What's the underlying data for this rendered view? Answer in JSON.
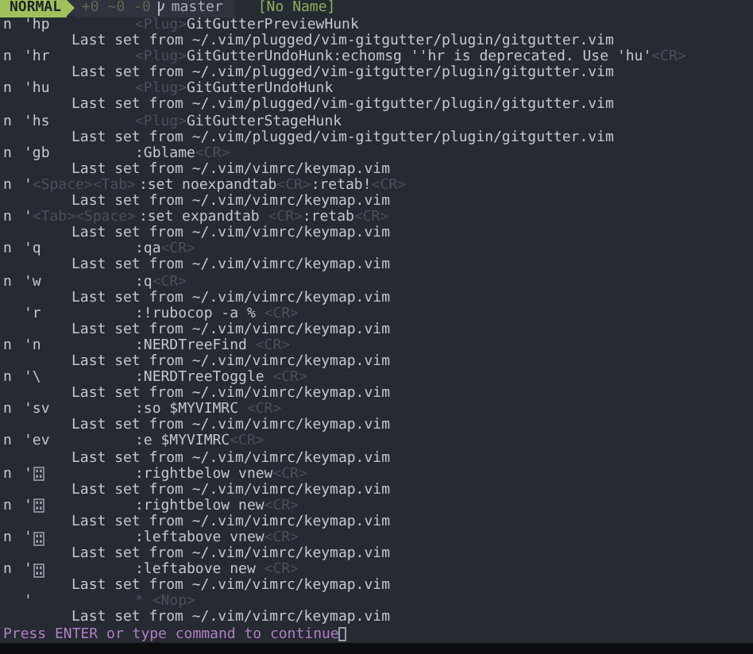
{
  "statusline": {
    "mode": "NORMAL",
    "git_changes": "+0 ~0 -0",
    "branch": "master",
    "filename": "[No Name]"
  },
  "mappings": [
    {
      "mode": "n",
      "lhs": [
        {
          "text": "'hp",
          "kind": "text"
        }
      ],
      "rhs": [
        {
          "text": "<Plug>",
          "kind": "special"
        },
        {
          "text": "GitGutterPreviewHunk",
          "kind": "text"
        }
      ],
      "source": "Last set from ~/.vim/plugged/vim-gitgutter/plugin/gitgutter.vim"
    },
    {
      "mode": "n",
      "lhs": [
        {
          "text": "'hr",
          "kind": "text"
        }
      ],
      "rhs": [
        {
          "text": "<Plug>",
          "kind": "special"
        },
        {
          "text": "GitGutterUndoHunk:echomsg ''hr is deprecated. Use 'hu'",
          "kind": "text"
        },
        {
          "text": "<CR>",
          "kind": "special"
        }
      ],
      "source": "Last set from ~/.vim/plugged/vim-gitgutter/plugin/gitgutter.vim"
    },
    {
      "mode": "n",
      "lhs": [
        {
          "text": "'hu",
          "kind": "text"
        }
      ],
      "rhs": [
        {
          "text": "<Plug>",
          "kind": "special"
        },
        {
          "text": "GitGutterUndoHunk",
          "kind": "text"
        }
      ],
      "source": "Last set from ~/.vim/plugged/vim-gitgutter/plugin/gitgutter.vim"
    },
    {
      "mode": "n",
      "lhs": [
        {
          "text": "'hs",
          "kind": "text"
        }
      ],
      "rhs": [
        {
          "text": "<Plug>",
          "kind": "special"
        },
        {
          "text": "GitGutterStageHunk",
          "kind": "text"
        }
      ],
      "source": "Last set from ~/.vim/plugged/vim-gitgutter/plugin/gitgutter.vim"
    },
    {
      "mode": "n",
      "lhs": [
        {
          "text": "'gb",
          "kind": "text"
        }
      ],
      "rhs": [
        {
          "text": ":Gblame",
          "kind": "text"
        },
        {
          "text": "<CR>",
          "kind": "special"
        }
      ],
      "source": "Last set from ~/.vim/vimrc/keymap.vim"
    },
    {
      "mode": "n",
      "lhs": [
        {
          "text": "'",
          "kind": "text"
        },
        {
          "text": "<Space><Tab>",
          "kind": "special"
        }
      ],
      "rhs": [
        {
          "text": ":set noexpandtab",
          "kind": "text"
        },
        {
          "text": "<CR>",
          "kind": "special"
        },
        {
          "text": ":retab!",
          "kind": "text"
        },
        {
          "text": "<CR>",
          "kind": "special"
        }
      ],
      "source": "Last set from ~/.vim/vimrc/keymap.vim"
    },
    {
      "mode": "n",
      "lhs": [
        {
          "text": "'",
          "kind": "text"
        },
        {
          "text": "<Tab><Space>",
          "kind": "special"
        }
      ],
      "rhs": [
        {
          "text": ":set expandtab ",
          "kind": "text"
        },
        {
          "text": "<CR>",
          "kind": "special"
        },
        {
          "text": ":retab",
          "kind": "text"
        },
        {
          "text": "<CR>",
          "kind": "special"
        }
      ],
      "source": "Last set from ~/.vim/vimrc/keymap.vim"
    },
    {
      "mode": "n",
      "lhs": [
        {
          "text": "'q",
          "kind": "text"
        }
      ],
      "rhs": [
        {
          "text": ":qa",
          "kind": "text"
        },
        {
          "text": "<CR>",
          "kind": "special"
        }
      ],
      "source": "Last set from ~/.vim/vimrc/keymap.vim"
    },
    {
      "mode": "n",
      "lhs": [
        {
          "text": "'w",
          "kind": "text"
        }
      ],
      "rhs": [
        {
          "text": ":q",
          "kind": "text"
        },
        {
          "text": "<CR>",
          "kind": "special"
        }
      ],
      "source": "Last set from ~/.vim/vimrc/keymap.vim"
    },
    {
      "lhs": [
        {
          "text": "'r",
          "kind": "text"
        }
      ],
      "rhs": [
        {
          "text": ":!rubocop -a % ",
          "kind": "text"
        },
        {
          "text": "<CR>",
          "kind": "special"
        }
      ],
      "source": "Last set from ~/.vim/vimrc/keymap.vim"
    },
    {
      "mode": "n",
      "lhs": [
        {
          "text": "'n",
          "kind": "text"
        }
      ],
      "rhs": [
        {
          "text": ":NERDTreeFind ",
          "kind": "text"
        },
        {
          "text": "<CR>",
          "kind": "special"
        }
      ],
      "source": "Last set from ~/.vim/vimrc/keymap.vim"
    },
    {
      "mode": "n",
      "lhs": [
        {
          "text": "'\\",
          "kind": "text"
        }
      ],
      "rhs": [
        {
          "text": ":NERDTreeToggle ",
          "kind": "text"
        },
        {
          "text": "<CR>",
          "kind": "special"
        }
      ],
      "source": "Last set from ~/.vim/vimrc/keymap.vim"
    },
    {
      "mode": "n",
      "lhs": [
        {
          "text": "'sv",
          "kind": "text"
        }
      ],
      "rhs": [
        {
          "text": ":so $MYVIMRC ",
          "kind": "text"
        },
        {
          "text": "<CR>",
          "kind": "special"
        }
      ],
      "source": "Last set from ~/.vim/vimrc/keymap.vim"
    },
    {
      "mode": "n",
      "lhs": [
        {
          "text": "'ev",
          "kind": "text"
        }
      ],
      "rhs": [
        {
          "text": ":e $MYVIMRC",
          "kind": "text"
        },
        {
          "text": "<CR>",
          "kind": "special"
        }
      ],
      "source": "Last set from ~/.vim/vimrc/keymap.vim"
    },
    {
      "mode": "n",
      "lhs": [
        {
          "text": "'",
          "kind": "text"
        },
        {
          "kind": "glyph"
        }
      ],
      "rhs": [
        {
          "text": ":rightbelow vnew",
          "kind": "text"
        },
        {
          "text": "<CR>",
          "kind": "special"
        }
      ],
      "source": "Last set from ~/.vim/vimrc/keymap.vim"
    },
    {
      "mode": "n",
      "lhs": [
        {
          "text": "'",
          "kind": "text"
        },
        {
          "kind": "glyph"
        }
      ],
      "rhs": [
        {
          "text": ":rightbelow new",
          "kind": "text"
        },
        {
          "text": "<CR>",
          "kind": "special"
        }
      ],
      "source": "Last set from ~/.vim/vimrc/keymap.vim"
    },
    {
      "mode": "n",
      "lhs": [
        {
          "text": "'",
          "kind": "text"
        },
        {
          "kind": "glyph"
        }
      ],
      "rhs": [
        {
          "text": ":leftabove vnew",
          "kind": "text"
        },
        {
          "text": "<CR>",
          "kind": "special"
        }
      ],
      "source": "Last set from ~/.vim/vimrc/keymap.vim"
    },
    {
      "mode": "n",
      "lhs": [
        {
          "text": "'",
          "kind": "text"
        },
        {
          "kind": "glyph"
        }
      ],
      "rhs": [
        {
          "text": ":leftabove new ",
          "kind": "text"
        },
        {
          "text": "<CR>",
          "kind": "special"
        }
      ],
      "source": "Last set from ~/.vim/vimrc/keymap.vim"
    },
    {
      "lhs": [
        {
          "text": "'",
          "kind": "text"
        }
      ],
      "rhs": [
        {
          "text": "*",
          "kind": "special"
        },
        {
          "text": " <Nop>",
          "kind": "special"
        }
      ],
      "source": "Last set from ~/.vim/vimrc/keymap.vim"
    }
  ],
  "prompt": "Press ENTER or type command to continue"
}
